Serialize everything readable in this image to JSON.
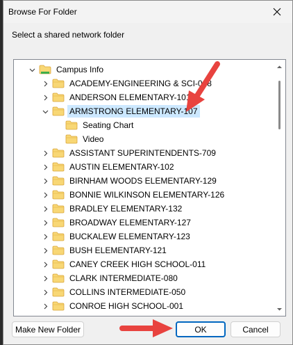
{
  "dialog": {
    "title": "Browse For Folder",
    "instruction": "Select a shared network folder"
  },
  "tree": {
    "items": [
      {
        "label": "Campus Info",
        "level": 0,
        "expanded": true,
        "icon": "network-folder-icon"
      },
      {
        "label": "ACADEMY-ENGINEERING & SCI-008",
        "level": 1,
        "expanded": false,
        "icon": "folder-icon"
      },
      {
        "label": "ANDERSON ELEMENTARY-101",
        "level": 1,
        "expanded": false,
        "icon": "folder-icon"
      },
      {
        "label": "ARMSTRONG ELEMENTARY-107",
        "level": 1,
        "expanded": true,
        "selected": true,
        "icon": "folder-icon"
      },
      {
        "label": "Seating Chart",
        "level": 2,
        "icon": "folder-icon"
      },
      {
        "label": "Video",
        "level": 2,
        "icon": "folder-icon"
      },
      {
        "label": "ASSISTANT SUPERINTENDENTS-709",
        "level": 1,
        "expanded": false,
        "icon": "folder-icon"
      },
      {
        "label": "AUSTIN ELEMENTARY-102",
        "level": 1,
        "expanded": false,
        "icon": "folder-icon"
      },
      {
        "label": "BIRNHAM WOODS ELEMENTARY-129",
        "level": 1,
        "expanded": false,
        "icon": "folder-icon"
      },
      {
        "label": "BONNIE WILKINSON ELEMENTARY-126",
        "level": 1,
        "expanded": false,
        "icon": "folder-icon"
      },
      {
        "label": "BRADLEY ELEMENTARY-132",
        "level": 1,
        "expanded": false,
        "icon": "folder-icon"
      },
      {
        "label": "BROADWAY ELEMENTARY-127",
        "level": 1,
        "expanded": false,
        "icon": "folder-icon"
      },
      {
        "label": "BUCKALEW ELEMENTARY-123",
        "level": 1,
        "expanded": false,
        "icon": "folder-icon"
      },
      {
        "label": "BUSH ELEMENTARY-121",
        "level": 1,
        "expanded": false,
        "icon": "folder-icon"
      },
      {
        "label": "CANEY CREEK HIGH SCHOOL-011",
        "level": 1,
        "expanded": false,
        "icon": "folder-icon"
      },
      {
        "label": "CLARK INTERMEDIATE-080",
        "level": 1,
        "expanded": false,
        "icon": "folder-icon"
      },
      {
        "label": "COLLINS INTERMEDIATE-050",
        "level": 1,
        "expanded": false,
        "icon": "folder-icon"
      },
      {
        "label": "CONROE HIGH SCHOOL-001",
        "level": 1,
        "expanded": false,
        "icon": "folder-icon"
      }
    ]
  },
  "buttons": {
    "make_new_folder": "Make New Folder",
    "ok": "OK",
    "cancel": "Cancel"
  },
  "colors": {
    "selection": "#cce8ff",
    "default_button_border": "#0067c0",
    "folder": "#f8d775",
    "annotation_arrow": "#e8433f"
  }
}
